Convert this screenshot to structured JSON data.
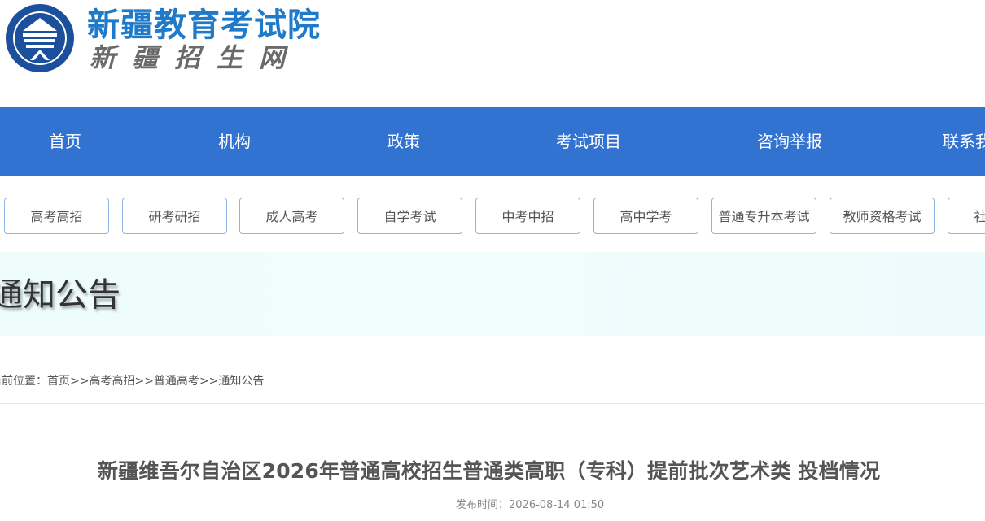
{
  "header": {
    "title": "新疆教育考试院",
    "subtitle": "新疆招生网",
    "emblem_text": "新疆教育考试院"
  },
  "main_nav": {
    "items": [
      "首页",
      "机构",
      "政策",
      "考试项目",
      "咨询举报",
      "联系我们"
    ]
  },
  "sub_nav": {
    "items": [
      "高考高招",
      "研考研招",
      "成人高考",
      "自学考试",
      "中考中招",
      "高中学考",
      "普通专升本考试",
      "教师资格考试",
      "社会考试"
    ]
  },
  "banner": {
    "title": "通知公告"
  },
  "breadcrumb": {
    "prefix": "当前位置：",
    "items": [
      "首页",
      "高考高招",
      "普通高考",
      "通知公告"
    ],
    "separator": ">>"
  },
  "article": {
    "title": "新疆维吾尔自治区2026年普通高校招生普通类高职（专科）提前批次艺术类 投档情况",
    "publish_label": "发布时间：",
    "publish_time": "2026-08-14 01:50"
  },
  "colors": {
    "nav_bg": "#3272d1",
    "brand_blue": "#1f7ac9",
    "banner_bg": "#eefcfc",
    "subnav_border": "#8db3e6"
  }
}
